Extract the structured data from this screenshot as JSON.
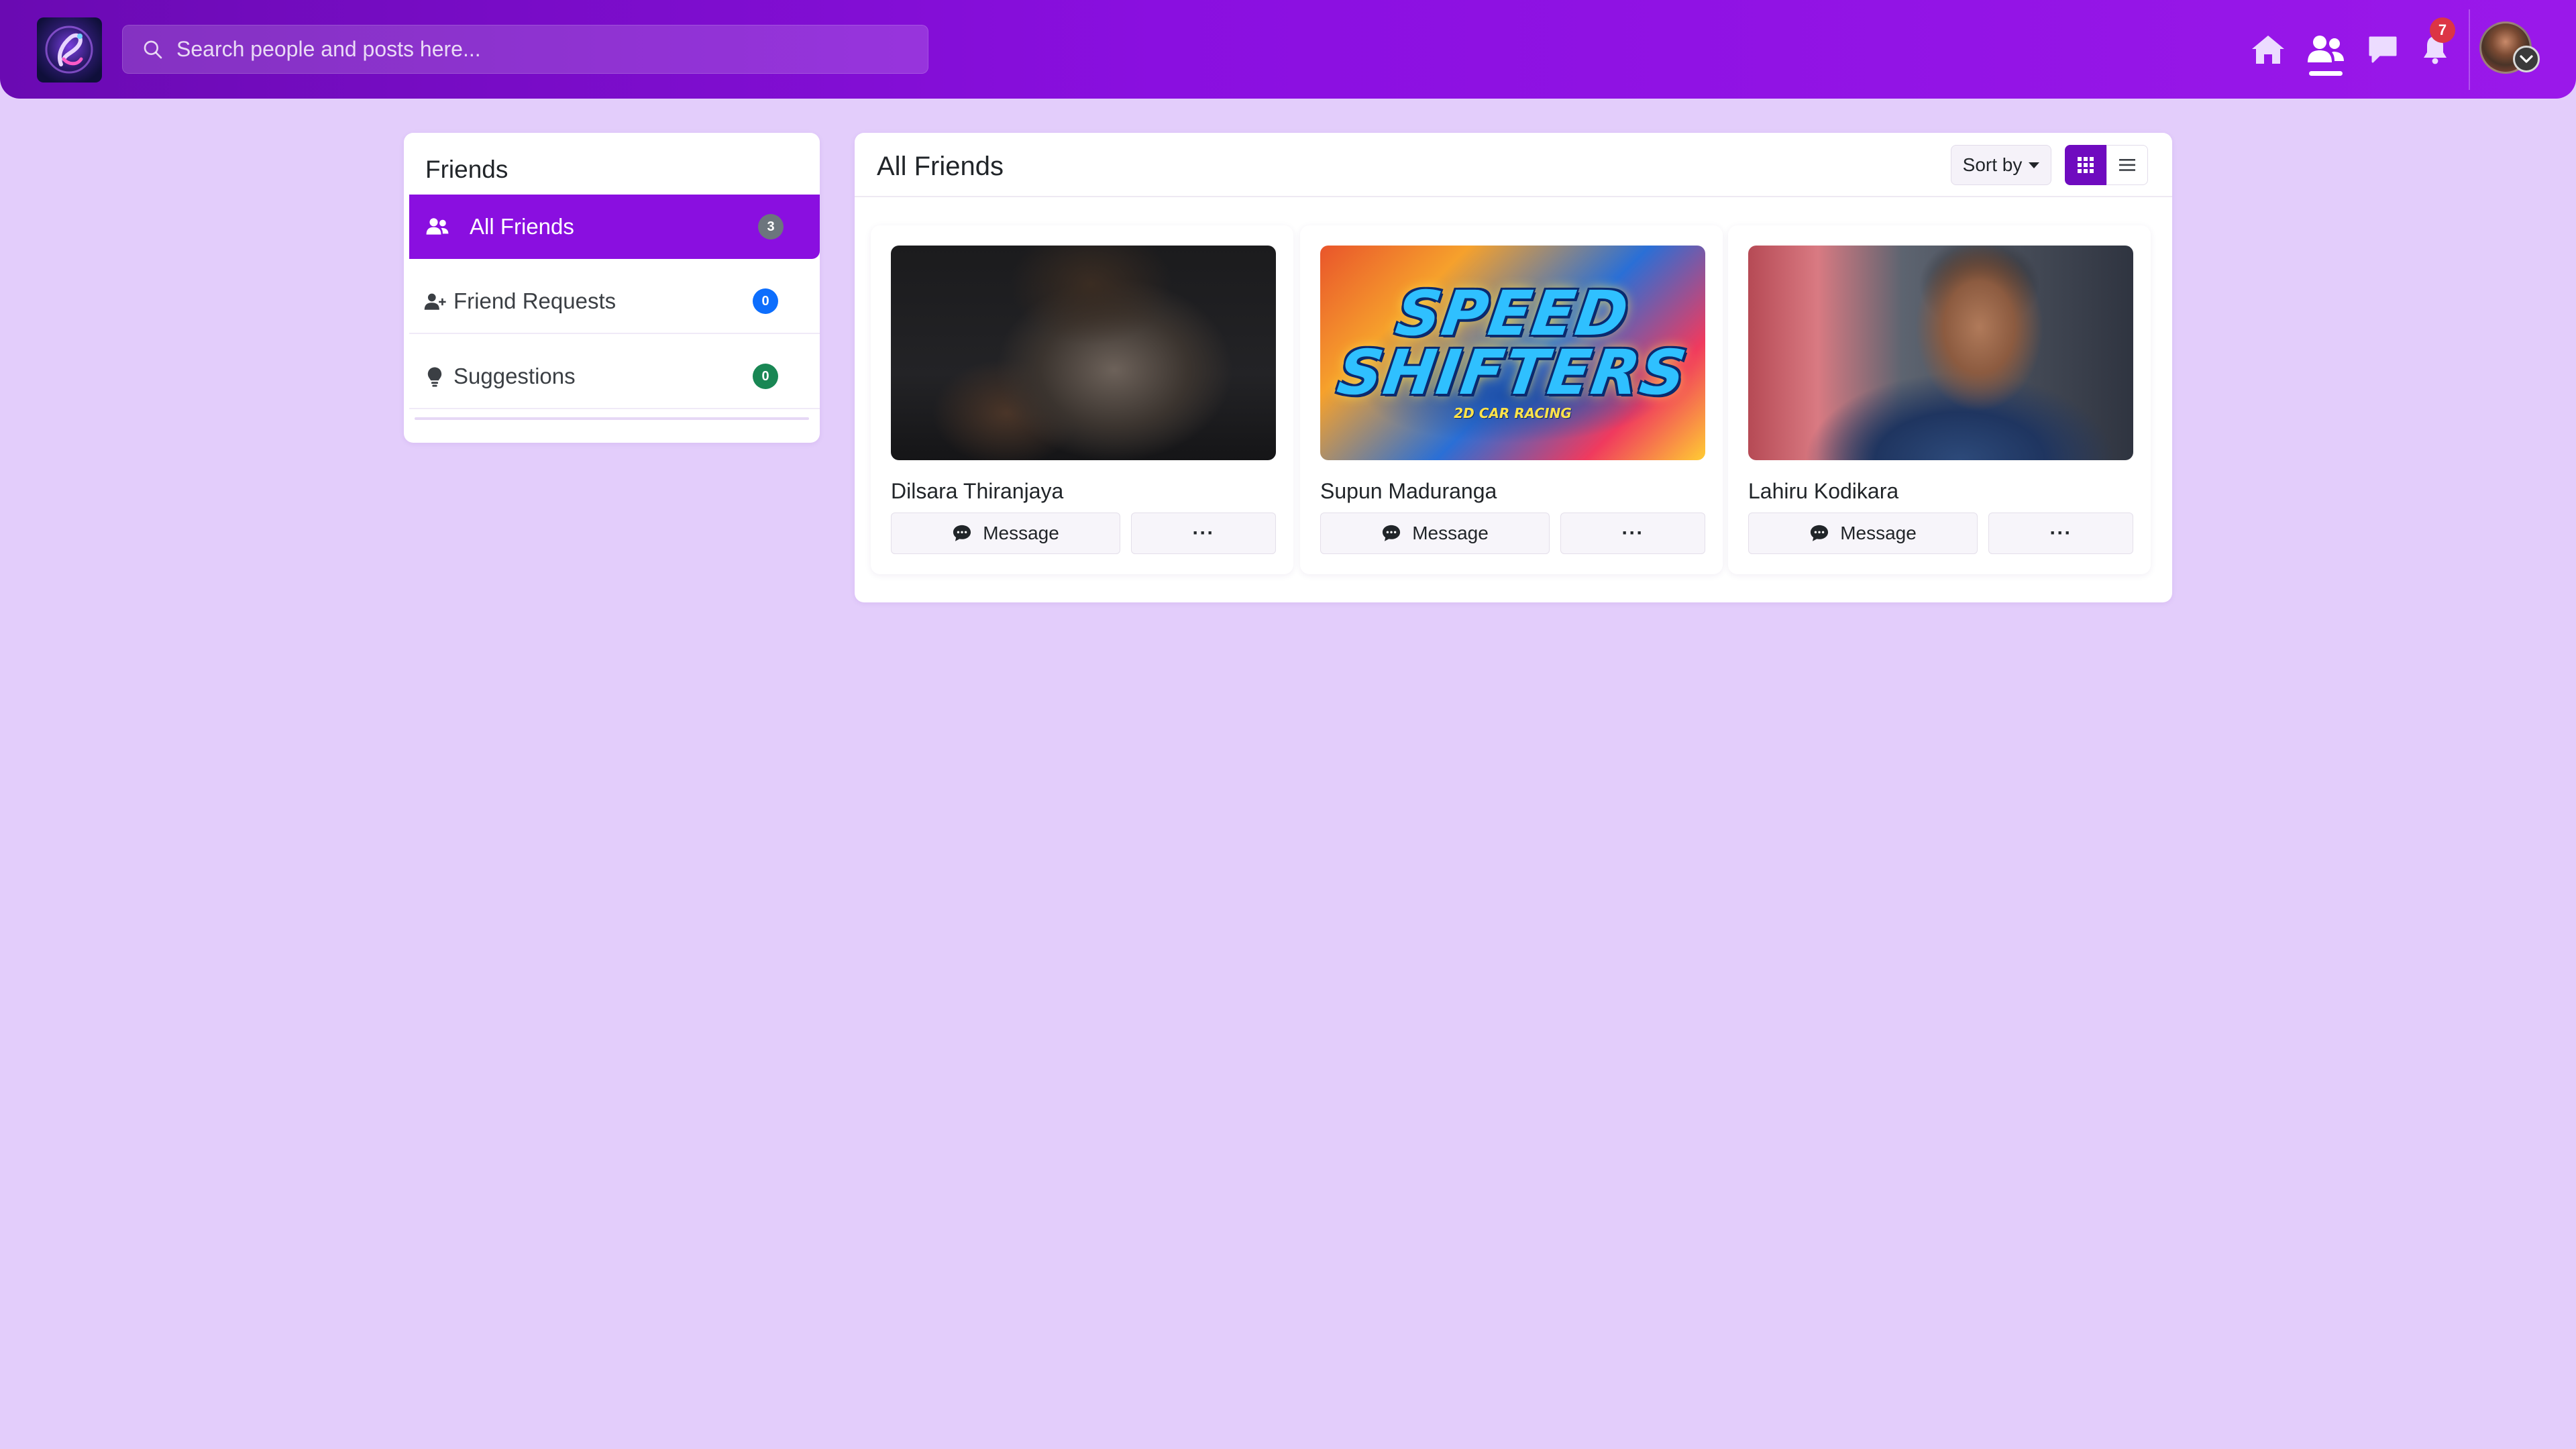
{
  "search": {
    "placeholder": "Search people and posts here..."
  },
  "nav": {
    "icons": [
      "home-icon",
      "friends-icon",
      "chat-icon",
      "bell-icon"
    ],
    "active": "friends-icon",
    "notification_count": "7"
  },
  "sidebar": {
    "title": "Friends",
    "items": [
      {
        "label": "All Friends",
        "count": "3",
        "icon": "users-icon",
        "badge_color": "#6c757d",
        "active": true
      },
      {
        "label": "Friend Requests",
        "count": "0",
        "icon": "user-plus-icon",
        "badge_color": "#0d6efd",
        "active": false
      },
      {
        "label": "Suggestions",
        "count": "0",
        "icon": "lightbulb-icon",
        "badge_color": "#198754",
        "active": false
      }
    ]
  },
  "main": {
    "title": "All Friends",
    "sort_label": "Sort by",
    "view_modes": [
      "grid",
      "list"
    ],
    "active_view": "grid"
  },
  "friends": [
    {
      "name": "Dilsara Thiranjaya",
      "message_label": "Message",
      "more_label": "···"
    },
    {
      "name": "Supun Maduranga",
      "message_label": "Message",
      "more_label": "···",
      "image_text": {
        "line1": "SPEED",
        "line2": "SHIFTERS",
        "line3": "2D CAR RACING"
      }
    },
    {
      "name": "Lahiru Kodikara",
      "message_label": "Message",
      "more_label": "···"
    }
  ],
  "colors": {
    "brand": "#8a0fe0",
    "background": "#e3cdfb",
    "active_view_button": "#6f0bbf",
    "notification_badge": "#dc3545"
  }
}
